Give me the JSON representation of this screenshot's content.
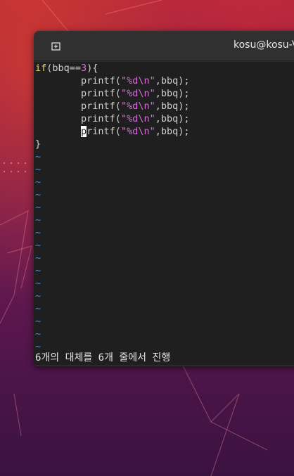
{
  "window": {
    "title": "kosu@kosu-V",
    "new_tab_icon": "new-tab-icon"
  },
  "editor": {
    "code": {
      "if_keyword": "if",
      "if_open": "(bbq==",
      "if_num": "3",
      "if_close": "){",
      "indent": "        ",
      "printf_lines": [
        {
          "fn": "printf(",
          "str": "\"%d\\n\"",
          "rest": ",bbq);"
        },
        {
          "fn": "printf(",
          "str": "\"%d\\n\"",
          "rest": ",bbq);"
        },
        {
          "fn": "printf(",
          "str": "\"%d\\n\"",
          "rest": ",bbq);"
        },
        {
          "fn": "printf(",
          "str": "\"%d\\n\"",
          "rest": ",bbq);"
        },
        {
          "cursor_char": "p",
          "fn": "rintf(",
          "str": "\"%d\\n\"",
          "rest": ",bbq);"
        }
      ],
      "closing_brace": "}"
    },
    "empty_line_marker": "~",
    "status_message": "6개의 대체를 6개 줄에서 진행"
  },
  "colors": {
    "keyword": "#e8d27a",
    "constant": "#d46fd6",
    "tilde": "#3e8fd8",
    "editor_bg": "#1f1f1f"
  }
}
